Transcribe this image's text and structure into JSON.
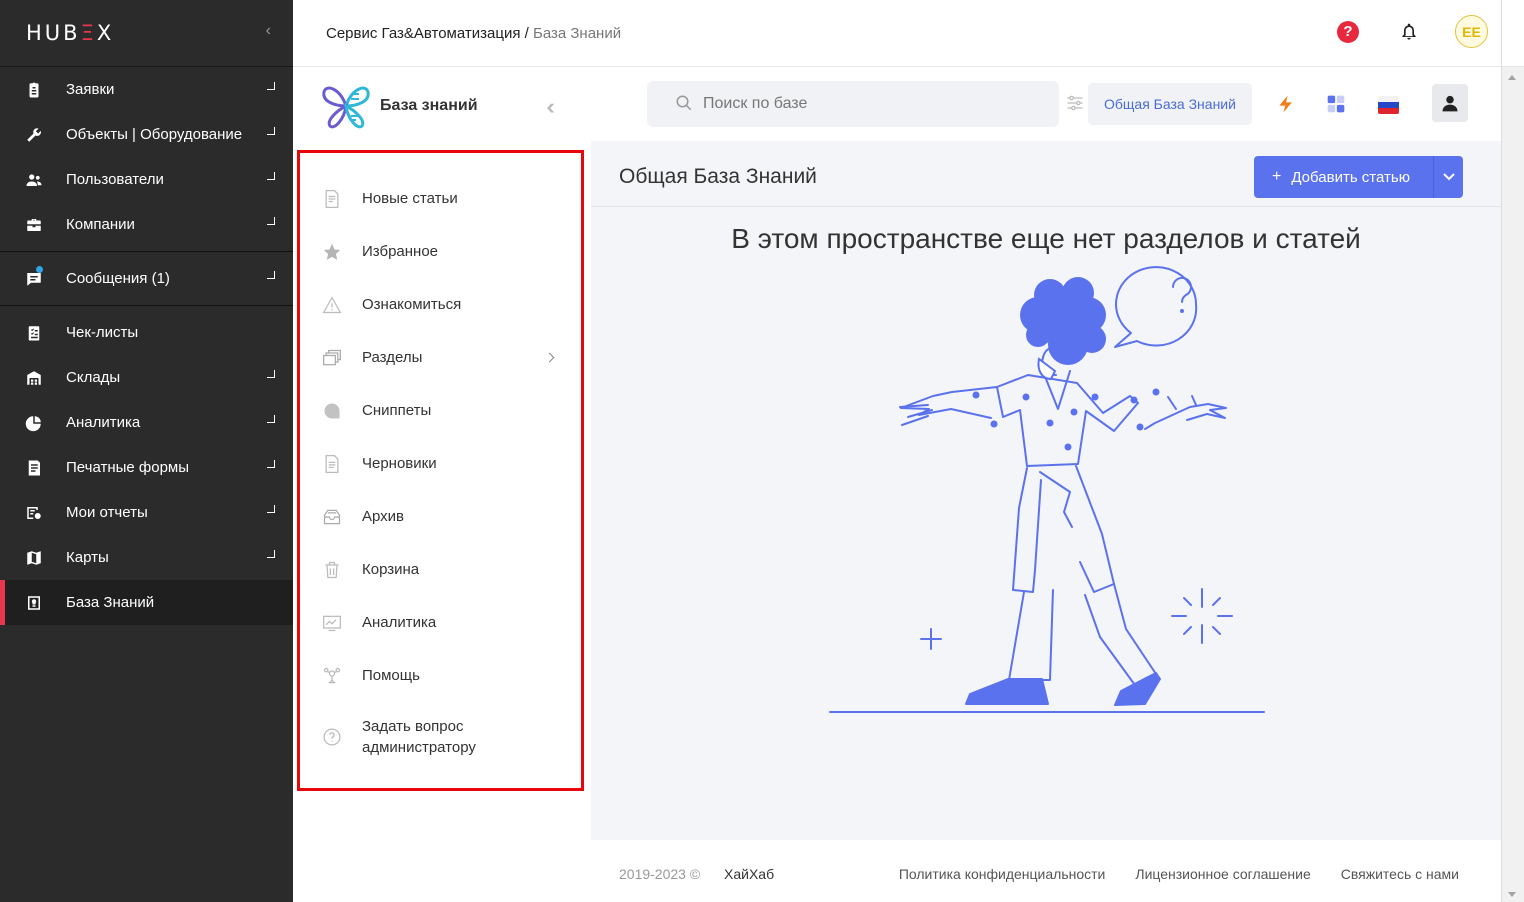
{
  "app": {
    "logo_text_a": "HUB",
    "logo_text_b": "Ξ",
    "logo_text_c": "X"
  },
  "sidebar": {
    "items": [
      {
        "label": "Заявки",
        "icon": "clipboard-icon"
      },
      {
        "label": "Объекты | Оборудование",
        "icon": "wrench-icon"
      },
      {
        "label": "Пользователи",
        "icon": "users-icon"
      },
      {
        "label": "Компании",
        "icon": "briefcase-icon"
      },
      {
        "label": "Сообщения (1)",
        "icon": "message-icon"
      },
      {
        "label": "Чек-листы",
        "icon": "checklist-icon"
      },
      {
        "label": "Склады",
        "icon": "warehouse-icon"
      },
      {
        "label": "Аналитика",
        "icon": "pie-chart-icon"
      },
      {
        "label": "Печатные формы",
        "icon": "print-form-icon"
      },
      {
        "label": "Мои отчеты",
        "icon": "report-icon"
      },
      {
        "label": "Карты",
        "icon": "map-icon"
      },
      {
        "label": "База Знаний",
        "icon": "knowledge-icon"
      }
    ]
  },
  "header": {
    "breadcrumb_parent": "Сервис Газ&Автоматизация",
    "breadcrumb_sep": " / ",
    "breadcrumb_current": "База Знаний",
    "avatar_initials": "EE"
  },
  "kb": {
    "title": "База знаний",
    "menu": [
      {
        "label": "Новые статьи"
      },
      {
        "label": "Избранное"
      },
      {
        "label": "Ознакомиться"
      },
      {
        "label": "Разделы"
      },
      {
        "label": "Сниппеты"
      },
      {
        "label": "Черновики"
      },
      {
        "label": "Архив"
      },
      {
        "label": "Корзина"
      },
      {
        "label": "Аналитика"
      },
      {
        "label": "Помощь"
      },
      {
        "label": "Задать вопрос администратору"
      }
    ]
  },
  "main": {
    "search_placeholder": "Поиск по базе",
    "kb_selector": "Общая База Знаний",
    "pane_title": "Общая База Знаний",
    "add_button": "Добавить статью",
    "empty_message": "В этом пространстве еще нет разделов и статей"
  },
  "footer": {
    "copyright": "2019-2023  ©",
    "brand": "ХайХаб",
    "links": [
      "Политика конфиденциальности",
      "Лицензионное соглашение",
      "Свяжитесь с нами"
    ]
  },
  "colors": {
    "accent": "#5b72ee",
    "danger": "#e8283c",
    "sidebar_bg": "#2b2b2b",
    "highlight_border": "#e8050b"
  }
}
